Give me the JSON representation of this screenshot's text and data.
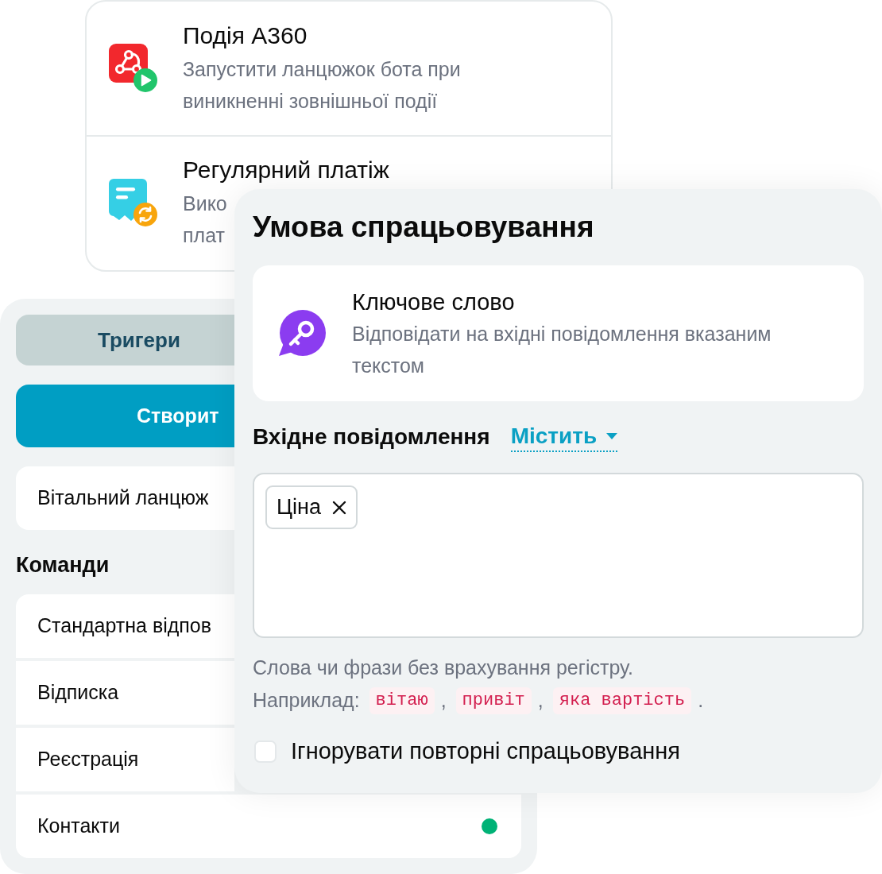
{
  "trigger_list": {
    "options": [
      {
        "kind": "webhook",
        "title": "Подія A360",
        "description": "Запустити ланцюжок бота при виникненні зовнішньої події"
      },
      {
        "kind": "payment",
        "title": "Регулярний платіж",
        "description": "Вико\nплат"
      }
    ]
  },
  "sidebar": {
    "tabs": [
      {
        "label": "Тригери",
        "selected": true
      }
    ],
    "create_button": "Створит",
    "chains": [
      {
        "label": "Вітальний ланцюж"
      }
    ],
    "commands_heading": "Команди",
    "commands": [
      {
        "label": "Стандартна відпов"
      },
      {
        "label": "Відписка"
      },
      {
        "label": "Реєстрація"
      },
      {
        "label": "Контакти",
        "color": "#00b276"
      }
    ]
  },
  "condition_panel": {
    "title": "Умова спрацьовування",
    "trigger_type": {
      "title": "Ключове слово",
      "description": "Відповідати на вхідні повідомлення вказаним текстом"
    },
    "incoming_label": "Вхідне повідомлення",
    "match_mode": "Містить",
    "keywords": [
      "Ціна"
    ],
    "hint": "Слова чи фрази без врахування регістру.",
    "example": [
      {
        "kind": "text",
        "text": "Наприклад:"
      },
      {
        "kind": "code",
        "text": "вітаю"
      },
      {
        "kind": "text",
        "text": ","
      },
      {
        "kind": "code",
        "text": "привіт"
      },
      {
        "kind": "text",
        "text": ","
      },
      {
        "kind": "code",
        "text": "яка вартість"
      },
      {
        "kind": "text",
        "text": "."
      }
    ],
    "ignore_repeats": {
      "label": "Ігнорувати повторні спрацьовування",
      "checked": false
    }
  }
}
